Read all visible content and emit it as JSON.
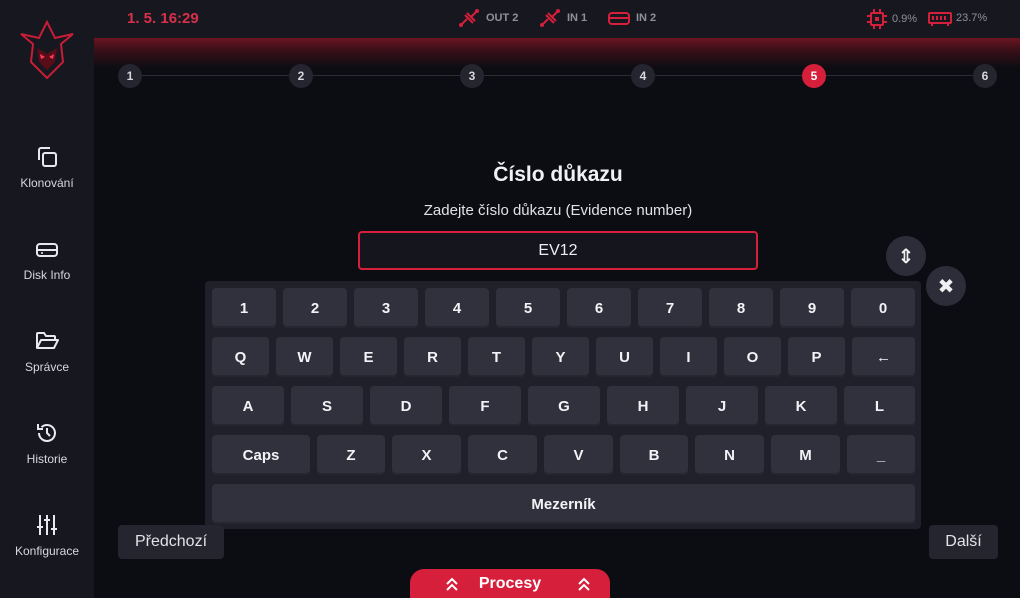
{
  "header": {
    "datetime": "1. 5. 16:29",
    "ports": [
      {
        "label": "OUT 2",
        "icon": "usb-cable-icon"
      },
      {
        "label": "IN 1",
        "icon": "usb-cable-icon"
      },
      {
        "label": "IN 2",
        "icon": "hard-drive-icon"
      }
    ],
    "cpu": "0.9%",
    "ram": "23.7%"
  },
  "sidebar": {
    "items": [
      {
        "label": "Klonování",
        "icon": "copy-icon"
      },
      {
        "label": "Disk Info",
        "icon": "hard-drive-icon"
      },
      {
        "label": "Správce",
        "icon": "folder-open-icon"
      },
      {
        "label": "Historie",
        "icon": "history-icon"
      },
      {
        "label": "Konfigurace",
        "icon": "sliders-icon"
      }
    ]
  },
  "stepper": {
    "steps": [
      "1",
      "2",
      "3",
      "4",
      "5",
      "6"
    ],
    "current": 5
  },
  "form": {
    "title": "Číslo důkazu",
    "subtitle": "Zadejte číslo důkazu (Evidence number)",
    "value": "EV12"
  },
  "buttons": {
    "resize": "⇕",
    "close": "✖",
    "prev": "Předchozí",
    "next": "Další",
    "procesy": "Procesy"
  },
  "keyboard": {
    "row1": [
      "1",
      "2",
      "3",
      "4",
      "5",
      "6",
      "7",
      "8",
      "9",
      "0"
    ],
    "row2": [
      "Q",
      "W",
      "E",
      "R",
      "T",
      "Y",
      "U",
      "I",
      "O",
      "P",
      "←"
    ],
    "row3": [
      "A",
      "S",
      "D",
      "F",
      "G",
      "H",
      "J",
      "K",
      "L"
    ],
    "row4": [
      "Caps",
      "Z",
      "X",
      "C",
      "V",
      "B",
      "N",
      "M",
      "_"
    ],
    "space": "Mezerník"
  },
  "colors": {
    "accent": "#d51f3b",
    "background": "#0c0d13",
    "sidebar": "#16171f",
    "key": "#30313c"
  }
}
